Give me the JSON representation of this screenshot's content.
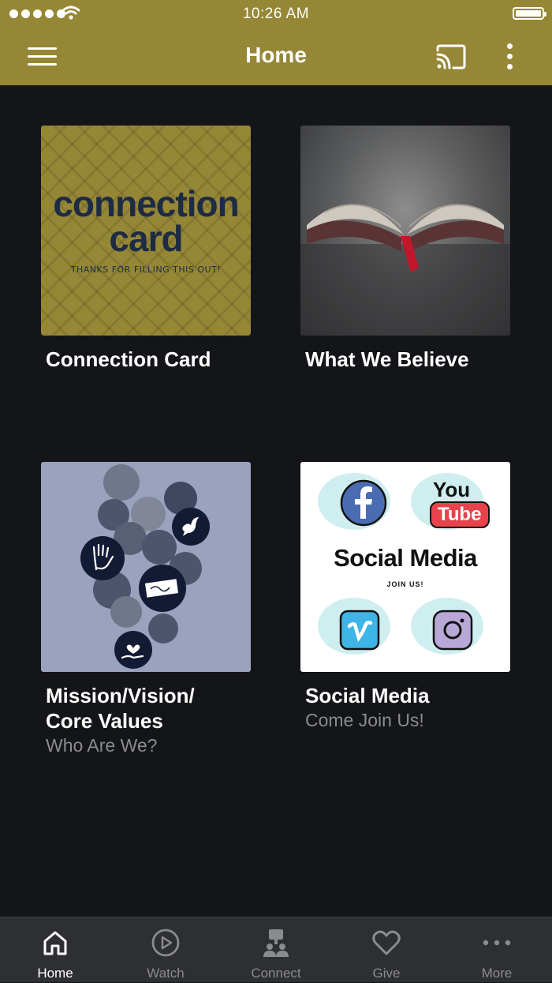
{
  "status_bar": {
    "time": "10:26 AM"
  },
  "header": {
    "title": "Home"
  },
  "tiles": [
    {
      "title": "Connection Card",
      "image": {
        "word1": "connection",
        "word2": "card",
        "tagline": "THANKS FOR FILLING THIS OUT!"
      }
    },
    {
      "title": "What We Believe"
    },
    {
      "title": "Mission/Vision/",
      "title2": "Core Values",
      "subtitle": "Who Are We?"
    },
    {
      "title": "Social Media",
      "subtitle": "Come Join Us!",
      "image": {
        "heading": "Social Media",
        "join": "JOIN US!",
        "you": "You",
        "tube": "Tube"
      }
    }
  ],
  "tabs": [
    {
      "label": "Home",
      "icon": "home-icon",
      "active": true
    },
    {
      "label": "Watch",
      "icon": "play-icon",
      "active": false
    },
    {
      "label": "Connect",
      "icon": "connect-icon",
      "active": false
    },
    {
      "label": "Give",
      "icon": "heart-icon",
      "active": false
    },
    {
      "label": "More",
      "icon": "more-dots-icon",
      "active": false
    }
  ],
  "colors": {
    "header_bg": "#958736",
    "page_bg": "#141518",
    "tabbar_bg": "#2e2f32",
    "text_primary": "#ffffff",
    "text_secondary": "#8a8b8f"
  }
}
